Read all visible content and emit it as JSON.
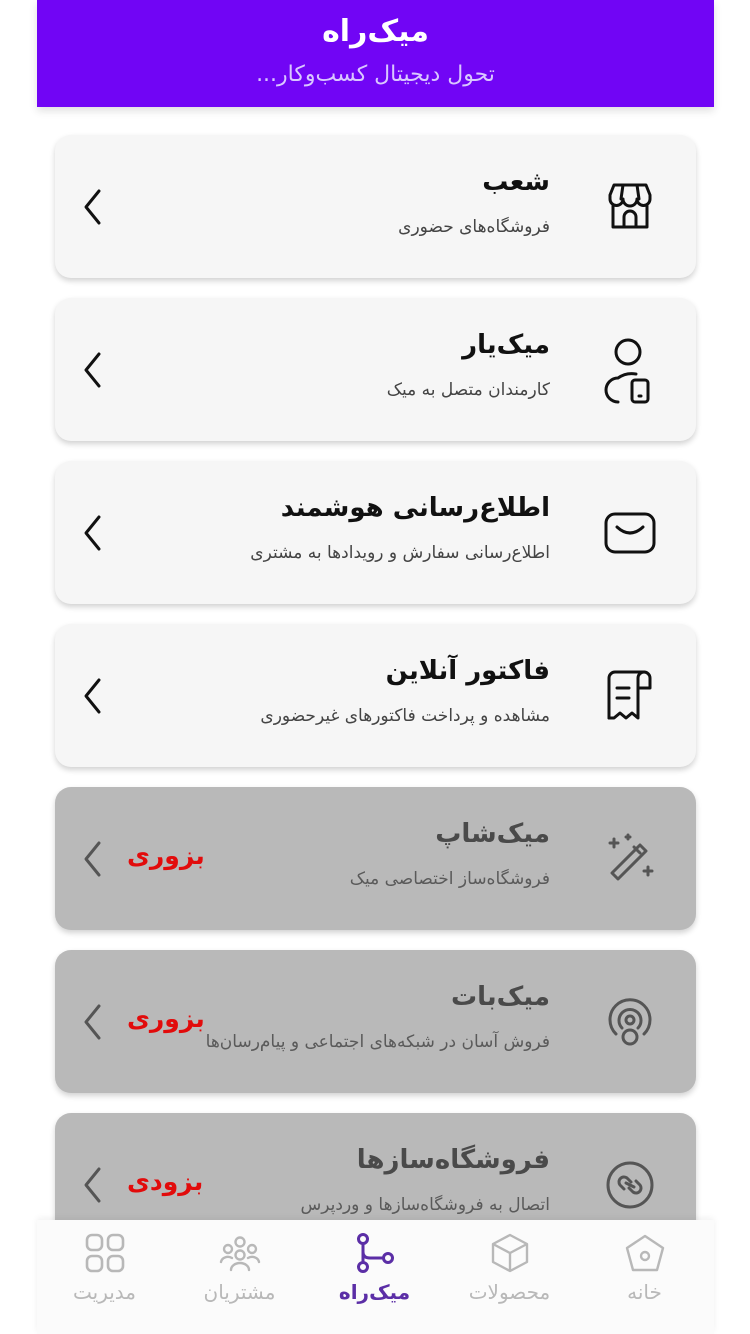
{
  "header": {
    "title": "میک‌راه",
    "subtitle": "تحول دیجیتال کسب‌وکار..."
  },
  "cards": [
    {
      "title": "شعب",
      "subtitle": "فروشگاه‌های حضوری",
      "icon": "store-icon",
      "disabled": false,
      "badge": ""
    },
    {
      "title": "میک‌یار",
      "subtitle": "کارمندان متصل به میک",
      "icon": "user-mobile-icon",
      "disabled": false,
      "badge": ""
    },
    {
      "title": "اطلاع‌رسانی هوشمند",
      "subtitle": "اطلاع‌رسانی سفارش و رویدادها به مشتری",
      "icon": "message-icon",
      "disabled": false,
      "badge": ""
    },
    {
      "title": "فاکتور آنلاین",
      "subtitle": "مشاهده و پرداخت فاکتورهای غیرحضوری",
      "icon": "invoice-icon",
      "disabled": false,
      "badge": ""
    },
    {
      "title": "میک‌شاپ",
      "subtitle": "فروشگاه‌ساز اختصاصی میک",
      "icon": "magic-wand-icon",
      "disabled": true,
      "badge": "بزوری"
    },
    {
      "title": "میک‌بات",
      "subtitle": "فروش آسان در شبکه‌های اجتماعی و پیام‌رسان‌ها",
      "icon": "bot-signal-icon",
      "disabled": true,
      "badge": "بزوری"
    },
    {
      "title": "فروشگاه‌سازها",
      "subtitle": "اتصال به فروشگاه‌سازها و وردپرس",
      "icon": "link-circle-icon",
      "disabled": true,
      "badge": "بزودی"
    }
  ],
  "nav": [
    {
      "label": "مدیریت",
      "icon": "grid-icon",
      "active": false
    },
    {
      "label": "مشتریان",
      "icon": "customers-icon",
      "active": false
    },
    {
      "label": "میک‌راه",
      "icon": "route-icon",
      "active": true
    },
    {
      "label": "محصولات",
      "icon": "box-icon",
      "active": false
    },
    {
      "label": "خانه",
      "icon": "home-icon",
      "active": false
    }
  ],
  "colors": {
    "primary": "#7105f5",
    "active_nav": "#5b2ea6",
    "soon_badge": "#e20b0b",
    "card_enabled": "#f6f6f6",
    "card_disabled": "#b9b9b9"
  }
}
